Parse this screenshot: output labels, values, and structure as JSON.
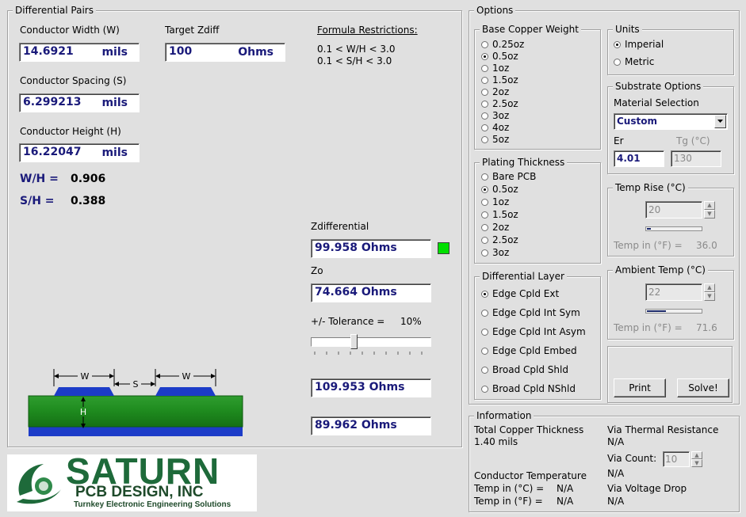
{
  "diff_pairs": {
    "title": "Differential Pairs",
    "width_label": "Conductor Width (W)",
    "width_value": "14.6921",
    "width_unit": "mils",
    "target_label": "Target Zdiff",
    "target_value": "100",
    "target_unit": "Ohms",
    "spacing_label": "Conductor Spacing (S)",
    "spacing_value": "6.299213",
    "spacing_unit": "mils",
    "height_label": "Conductor Height (H)",
    "height_value": "16.22047",
    "height_unit": "mils",
    "wh_label": "W/H =",
    "wh_value": "0.906",
    "sh_label": "S/H =",
    "sh_value": "0.388",
    "formula_title": "Formula Restrictions:",
    "formula_1": "0.1 < W/H < 3.0",
    "formula_2": "0.1 < S/H < 3.0",
    "zdiff_label": "Zdifferential",
    "zdiff_value": "99.958 Ohms",
    "status_color": "#00e000",
    "zo_label": "Zo",
    "zo_value": "74.664 Ohms",
    "tolerance_label": "+/- Tolerance =",
    "tolerance_value": "10%",
    "tolerance_slider_fraction": 0.35,
    "upper_value": "109.953 Ohms",
    "lower_value": "89.962 Ohms",
    "diagram": {
      "w": "W",
      "s": "S",
      "h": "H"
    }
  },
  "logo": {
    "company": "SATURN",
    "subtitle": "PCB DESIGN, INC",
    "tagline": "Turnkey Electronic Engineering Solutions"
  },
  "options": {
    "title": "Options",
    "copper_weight": {
      "title": "Base Copper Weight",
      "items": [
        "0.25oz",
        "0.5oz",
        "1oz",
        "1.5oz",
        "2oz",
        "2.5oz",
        "3oz",
        "4oz",
        "5oz"
      ],
      "selected": "0.5oz"
    },
    "units": {
      "title": "Units",
      "items": [
        "Imperial",
        "Metric"
      ],
      "selected": "Imperial"
    },
    "substrate": {
      "title": "Substrate Options",
      "material_label": "Material Selection",
      "material_value": "Custom",
      "er_label": "Er",
      "er_value": "4.01",
      "tg_label": "Tg (°C)",
      "tg_value": "130"
    },
    "plating": {
      "title": "Plating Thickness",
      "items": [
        "Bare PCB",
        "0.5oz",
        "1oz",
        "1.5oz",
        "2oz",
        "2.5oz",
        "3oz"
      ],
      "selected": "0.5oz"
    },
    "temp_rise": {
      "title": "Temp Rise (°C)",
      "value": "20",
      "f_label": "Temp in (°F) =",
      "f_value": "36.0",
      "bar_fraction": 0.08
    },
    "diff_layer": {
      "title": "Differential Layer",
      "items": [
        "Edge Cpld Ext",
        "Edge Cpld Int Sym",
        "Edge Cpld Int Asym",
        "Edge Cpld Embed",
        "Broad Cpld Shld",
        "Broad Cpld NShld"
      ],
      "selected": "Edge Cpld Ext"
    },
    "ambient": {
      "title": "Ambient Temp (°C)",
      "value": "22",
      "f_label": "Temp in (°F) =",
      "f_value": "71.6",
      "bar_fraction": 0.36
    },
    "print_label": "Print",
    "solve_label": "Solve!"
  },
  "information": {
    "title": "Information",
    "copper_thickness_label": "Total Copper Thickness",
    "copper_thickness_value": "1.40 mils",
    "via_thermal_label": "Via Thermal Resistance",
    "via_thermal_value": "N/A",
    "via_count_label": "Via Count:",
    "via_count_value": "10",
    "conductor_temp_label": "Conductor Temperature",
    "conductor_temp_value": "N/A",
    "temp_c_label": "Temp in (°C) =",
    "temp_c_value": "N/A",
    "temp_f_label": "Temp in (°F) =",
    "temp_f_value": "N/A",
    "via_voltage_label": "Via Voltage Drop",
    "via_voltage_value": "N/A"
  }
}
